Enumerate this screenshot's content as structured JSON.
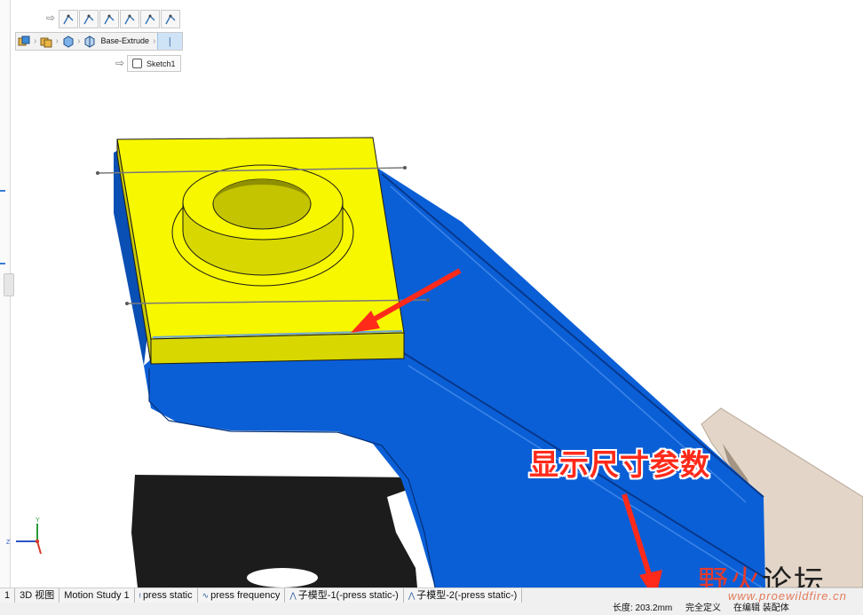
{
  "breadcrumb": {
    "feature_label": "Base-Extrude",
    "sketch_label": "Sketch1"
  },
  "tool_strip": {
    "icon": "sketch-line-icon",
    "count": 6
  },
  "annotation": {
    "text": "显示尺寸参数",
    "color": "#ff2a1a"
  },
  "triad": {
    "y": "Y",
    "z": "Z"
  },
  "watermark": {
    "text_red": "野火",
    "text_black": "论坛",
    "url": "www.proewildfire.cn"
  },
  "tabs": [
    {
      "label": "1",
      "icon": ""
    },
    {
      "label": "3D 视图",
      "icon": ""
    },
    {
      "label": "Motion Study 1",
      "icon": ""
    },
    {
      "label": "press static",
      "icon": "simulation-static-icon"
    },
    {
      "label": "press frequency",
      "icon": "simulation-frequency-icon"
    },
    {
      "label": "子模型-1(-press static-)",
      "icon": "submodel-icon"
    },
    {
      "label": "子模型-2(-press static-)",
      "icon": "submodel-icon"
    }
  ],
  "status": {
    "length": "长度: 203.2mm",
    "definition": "完全定义",
    "editing": "在编辑 装配体"
  },
  "colors": {
    "top_plate": "#f7f700",
    "top_plate_side": "#d8d800",
    "bracket": "#0b5fd6",
    "bracket_dark": "#0a4fb4",
    "arrow": "#ff2a1a"
  }
}
